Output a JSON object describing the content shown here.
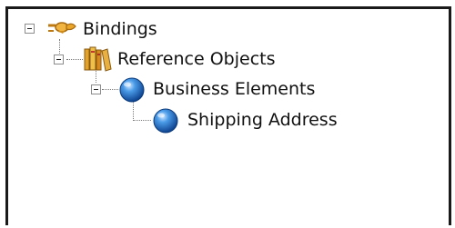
{
  "tree": {
    "nodes": [
      {
        "label": "Bindings",
        "icon": "bindings-icon",
        "expanded": true
      },
      {
        "label": "Reference Objects",
        "icon": "reference-objects-icon",
        "expanded": true
      },
      {
        "label": "Business Elements",
        "icon": "globe-icon",
        "expanded": true
      },
      {
        "label": "Shipping Address",
        "icon": "globe-icon",
        "expanded": false
      }
    ]
  },
  "colors": {
    "globe": "#1f6fc9",
    "books": "#d98a1c",
    "bindings": "#e0a020"
  }
}
